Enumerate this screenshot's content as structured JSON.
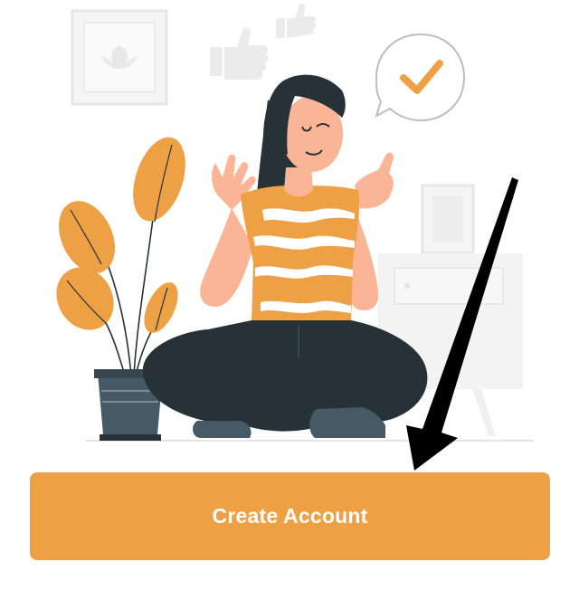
{
  "illustration": {
    "icon": "woman-thumbs-up-illustration"
  },
  "cta": {
    "label": "Create Account"
  },
  "annotation": {
    "icon": "arrow-pointer-icon"
  },
  "colors": {
    "accent": "#EDA144",
    "dark": "#263238",
    "skin": "#F9B596",
    "light_gray": "#EBEBEB",
    "black": "#000000"
  }
}
